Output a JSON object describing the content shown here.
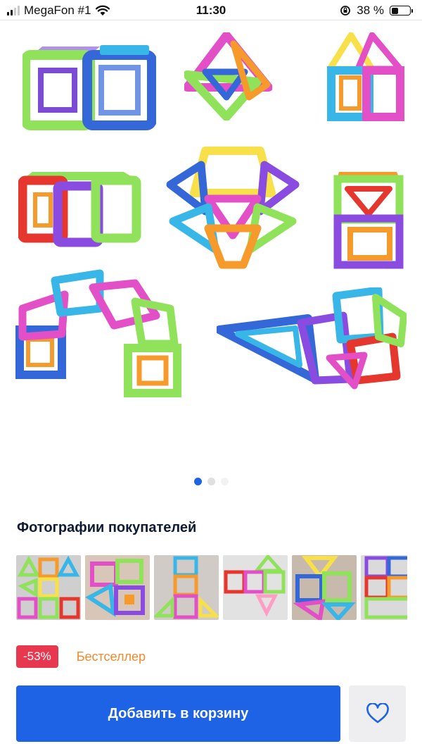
{
  "status_bar": {
    "carrier": "MegaFon #1",
    "time": "11:30",
    "battery_percent": "38 %",
    "battery_level": 0.38,
    "signal_bars": 2,
    "icons": [
      "signal-icon",
      "wifi-icon",
      "orientation-lock-icon",
      "battery-icon"
    ]
  },
  "gallery": {
    "images_count": 3,
    "active_index": 0
  },
  "customer_photos": {
    "title": "Фотографии покупателей",
    "count_visible": 6
  },
  "product": {
    "discount": "-53%",
    "bestseller_label": "Бестселлер"
  },
  "actions": {
    "add_to_cart": "Добавить в корзину",
    "favorite_icon": "heart-icon"
  },
  "colors": {
    "accent": "#1e62e6",
    "discount_badge": "#e8384f",
    "bestseller_text": "#f28a2e",
    "title_text": "#0d1b34",
    "fav_bg": "#eeeef0"
  }
}
